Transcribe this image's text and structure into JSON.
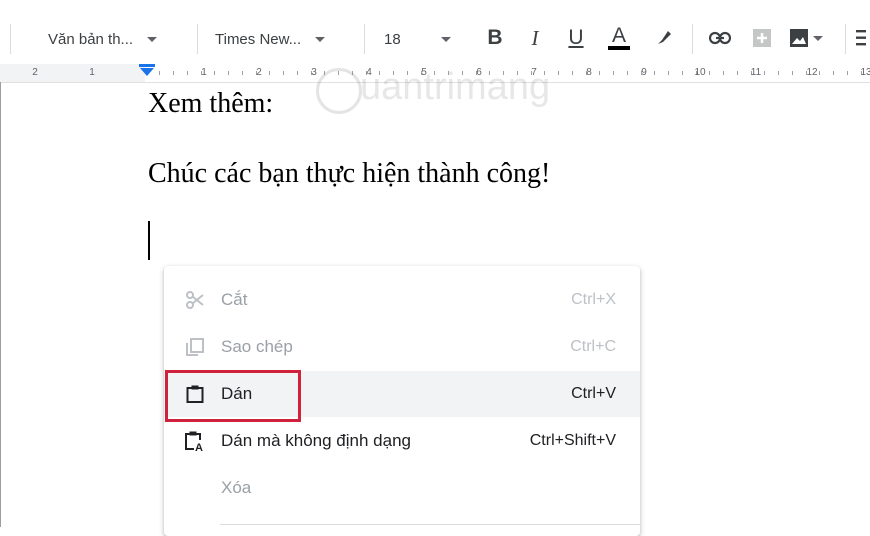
{
  "toolbar": {
    "style_dropdown": "Văn bản th...",
    "font_dropdown": "Times New...",
    "font_size": "18",
    "bold": "B",
    "italic": "I",
    "underline": "U",
    "text_color": "A"
  },
  "ruler": {
    "left_numbers": [
      "2",
      "1"
    ],
    "right_numbers": [
      "1",
      "2",
      "3",
      "4",
      "5",
      "6",
      "7",
      "8",
      "9",
      "10",
      "11",
      "12",
      "13"
    ]
  },
  "document": {
    "line1": "Xem thêm:",
    "line2": "Chúc các bạn thực hiện thành công!"
  },
  "watermark": {
    "text": "uantrimang"
  },
  "context_menu": {
    "items": [
      {
        "label": "Cắt",
        "shortcut": "Ctrl+X",
        "icon": "scissors-icon",
        "enabled": false
      },
      {
        "label": "Sao chép",
        "shortcut": "Ctrl+C",
        "icon": "copy-icon",
        "enabled": false
      },
      {
        "label": "Dán",
        "shortcut": "Ctrl+V",
        "icon": "clipboard-icon",
        "enabled": true
      },
      {
        "label": "Dán mà không định dạng",
        "shortcut": "Ctrl+Shift+V",
        "icon": "paste-plain-icon",
        "enabled": true
      },
      {
        "label": "Xóa",
        "shortcut": "",
        "icon": "",
        "enabled": false
      }
    ]
  },
  "colors": {
    "accent": "#1a73e8",
    "highlight_border": "#d1223d"
  }
}
